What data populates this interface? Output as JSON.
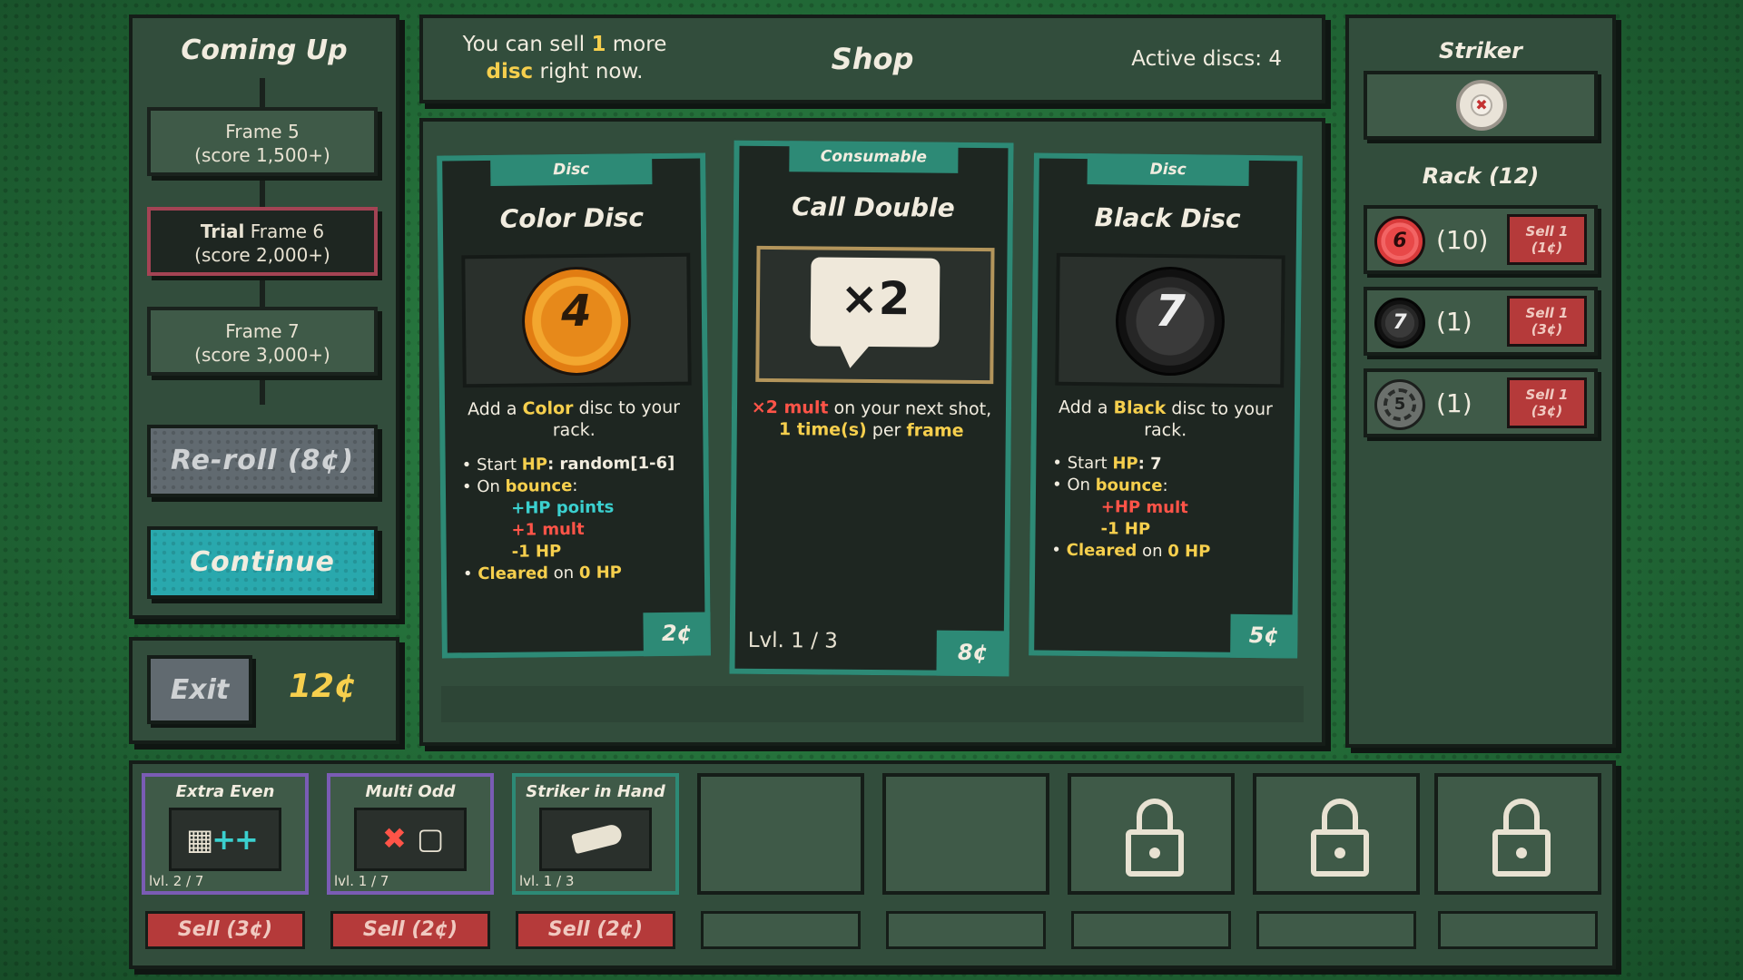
{
  "coming_up": {
    "title": "Coming Up",
    "frames": [
      {
        "label": "Frame 5",
        "score": "(score 1,500+)"
      },
      {
        "label_bold": "Trial",
        "label": "Frame 6",
        "score": "(score 2,000+)"
      },
      {
        "label": "Frame 7",
        "score": "(score 3,000+)"
      }
    ],
    "reroll_label": "Re-roll (8¢)",
    "continue_label": "Continue"
  },
  "footer_left": {
    "exit_label": "Exit",
    "money": "12¢"
  },
  "shop_header": {
    "sell_text_1": "You can sell",
    "sell_count": "1",
    "sell_text_2": "more",
    "sell_disc": "disc",
    "sell_text_3": "right now.",
    "title": "Shop",
    "active_discs": "Active discs: 4"
  },
  "cards": [
    {
      "tag": "Disc",
      "title": "Color Disc",
      "disc_number": "4",
      "desc_1": "Add a",
      "desc_key": "Color",
      "desc_2": "disc to your rack.",
      "hp_label": "Start",
      "hp_key": "HP",
      "hp_value": ": random[1-6]",
      "on_label": "On",
      "on_key": "bounce",
      "on_colon": ":",
      "effect_1": "+HP points",
      "effect_2": "+1 mult",
      "effect_3": "-1 HP",
      "cleared_key": "Cleared",
      "cleared_mid": "on",
      "cleared_hp": "0 HP",
      "price": "2¢"
    },
    {
      "tag": "Consumable",
      "title": "Call Double",
      "bubble": "×2",
      "desc_mult": "×2 mult",
      "desc_1": "on your next shot,",
      "desc_times": "1 time(s)",
      "desc_per": "per",
      "desc_frame": "frame",
      "level": "Lvl. 1 / 3",
      "price": "8¢"
    },
    {
      "tag": "Disc",
      "title": "Black Disc",
      "disc_number": "7",
      "desc_1": "Add a",
      "desc_key": "Black",
      "desc_2": "disc to your rack.",
      "hp_label": "Start",
      "hp_key": "HP",
      "hp_value": ": 7",
      "on_label": "On",
      "on_key": "bounce",
      "on_colon": ":",
      "effect_1": "+HP mult",
      "effect_2": "-1 HP",
      "cleared_key": "Cleared",
      "cleared_mid": "on",
      "cleared_hp": "0 HP",
      "price": "5¢"
    }
  ],
  "striker": {
    "title": "Striker"
  },
  "rack": {
    "title": "Rack (12)",
    "items": [
      {
        "disc": "6",
        "count": "(10)",
        "sell_1": "Sell 1",
        "sell_2": "(1¢)"
      },
      {
        "disc": "7",
        "count": "(1)",
        "sell_1": "Sell 1",
        "sell_2": "(3¢)"
      },
      {
        "disc": "5",
        "count": "(1)",
        "sell_1": "Sell 1",
        "sell_2": "(3¢)"
      }
    ]
  },
  "slots": [
    {
      "name": "Extra Even",
      "level": "lvl. 2 / 7",
      "sell": "Sell (3¢)"
    },
    {
      "name": "Multi Odd",
      "level": "lvl. 1 / 7",
      "sell": "Sell (2¢)"
    },
    {
      "name": "Striker in Hand",
      "level": "lvl. 1 / 3",
      "sell": "Sell (2¢)"
    }
  ],
  "colors": {
    "panel": "#324d3c",
    "teal": "#2d8a76",
    "yellow": "#f6cf4d",
    "cyan": "#3bd0cf",
    "red": "#ff5448",
    "sell_red": "#b53a3a",
    "continue": "#29a8ad",
    "reroll": "#616a70",
    "trial_border": "#a44354"
  }
}
